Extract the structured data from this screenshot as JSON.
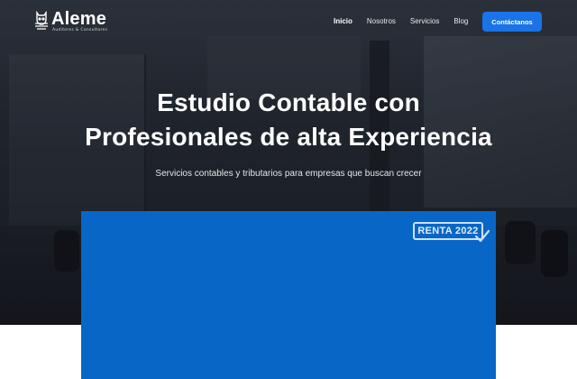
{
  "brand": {
    "name": "Aleme",
    "tagline": "Auditores & Consultores"
  },
  "nav": {
    "items": [
      {
        "label": "Inicio",
        "active": true
      },
      {
        "label": "Nosotros",
        "active": false
      },
      {
        "label": "Servicios",
        "active": false
      },
      {
        "label": "Blog",
        "active": false
      }
    ],
    "cta_label": "Contáctanos"
  },
  "hero": {
    "title_line1": "Estudio Contable con",
    "title_line2": "Profesionales de alta Experiencia",
    "subtitle": "Servicios contables y tributarios para empresas que buscan crecer"
  },
  "media": {
    "badge_text": "RENTA 2022"
  },
  "colors": {
    "accent": "#1a73e8",
    "card_blue": "#0866c7",
    "hero_dark": "#22272f"
  },
  "icons": {
    "logo": "owl-logo-icon",
    "badge_check": "check-icon"
  }
}
